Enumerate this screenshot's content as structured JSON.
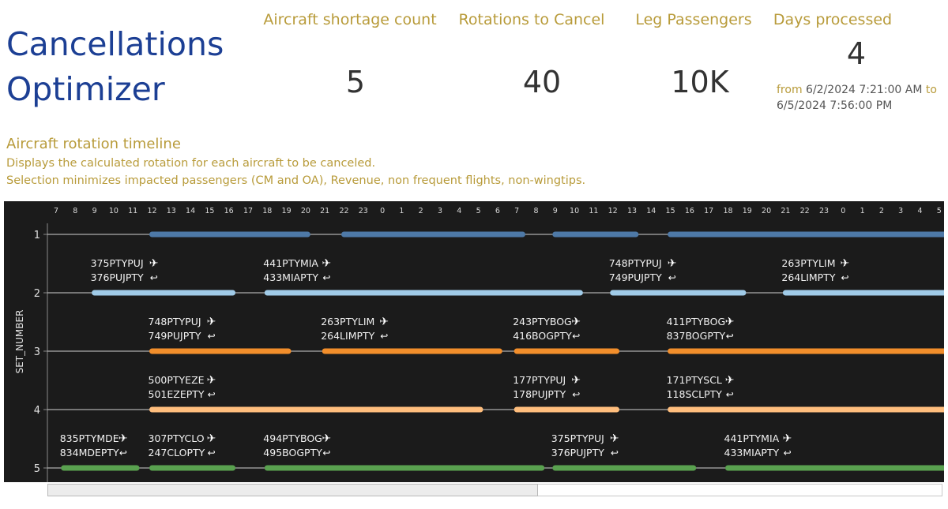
{
  "header": {
    "title": "Cancellations Optimizer"
  },
  "kpis": [
    {
      "label": "Aircraft shortage count",
      "value": "5"
    },
    {
      "label": "Rotations to Cancel",
      "value": "40"
    },
    {
      "label": "Leg Passengers",
      "value": "10K"
    },
    {
      "label": "Days processed",
      "value": "4"
    }
  ],
  "date_range": {
    "from_word": "from",
    "from": "6/2/2024 7:21:00 AM",
    "to_word": "to",
    "to": "6/5/2024 7:56:00 PM"
  },
  "section": {
    "title": "Aircraft rotation timeline",
    "desc1": "Displays the calculated rotation for each aircraft to be canceled.",
    "desc2": "Selection minimizes impacted passengers (CM and OA),  Revenue, non frequent flights, non-wingtips."
  },
  "chart_data": {
    "type": "gantt",
    "ylabel": "SET_NUMBER",
    "x_hours": [
      "7",
      "8",
      "9",
      "10",
      "11",
      "12",
      "13",
      "14",
      "15",
      "16",
      "17",
      "18",
      "19",
      "20",
      "21",
      "22",
      "23",
      "0",
      "1",
      "2",
      "3",
      "4",
      "5",
      "6",
      "7",
      "8",
      "9",
      "10",
      "11",
      "12",
      "13",
      "14",
      "15",
      "16",
      "17",
      "18",
      "19",
      "20",
      "21",
      "22",
      "23",
      "0",
      "1",
      "2",
      "3",
      "4",
      "5"
    ],
    "x_start_hour": 7,
    "x_end_hour": 53.5,
    "series": [
      {
        "set": 1,
        "color": "#4e79a7",
        "bars": [
          [
            12,
            20.1
          ],
          [
            22,
            31.3
          ],
          [
            33,
            37.2
          ],
          [
            39,
            53.5
          ]
        ],
        "labels": []
      },
      {
        "set": 2,
        "color": "#a0cbe8",
        "bars": [
          [
            9,
            16.2
          ],
          [
            18,
            34.3
          ],
          [
            36,
            42.8
          ],
          [
            45,
            53.5
          ]
        ],
        "labels": [
          {
            "at": 9,
            "out": "375PTYPUJ",
            "ret": "376PUJPTY"
          },
          {
            "at": 18,
            "out": "441PTYMIA",
            "ret": "433MIAPTY"
          },
          {
            "at": 36,
            "out": "748PTYPUJ",
            "ret": "749PUJPTY"
          },
          {
            "at": 45,
            "out": "263PTYLIM",
            "ret": "264LIMPTY"
          }
        ]
      },
      {
        "set": 3,
        "color": "#f28e2b",
        "bars": [
          [
            12,
            19.1
          ],
          [
            21,
            30.1
          ],
          [
            31,
            36.2
          ],
          [
            39,
            53.5
          ]
        ],
        "labels": [
          {
            "at": 12,
            "out": "748PTYPUJ",
            "ret": "749PUJPTY"
          },
          {
            "at": 21,
            "out": "263PTYLIM",
            "ret": "264LIMPTY"
          },
          {
            "at": 31,
            "out": "243PTYBOG",
            "ret": "416BOGPTY"
          },
          {
            "at": 39,
            "out": "411PTYBOG",
            "ret": "837BOGPTY"
          }
        ]
      },
      {
        "set": 4,
        "color": "#ffbe7d",
        "bars": [
          [
            12,
            29.1
          ],
          [
            31,
            36.2
          ],
          [
            39,
            53.5
          ]
        ],
        "labels": [
          {
            "at": 12,
            "out": "500PTYEZE",
            "ret": "501EZEPTY"
          },
          {
            "at": 31,
            "out": "177PTYPUJ",
            "ret": "178PUJPTY"
          },
          {
            "at": 39,
            "out": "171PTYSCL",
            "ret": "118SCLPTY"
          }
        ]
      },
      {
        "set": 5,
        "color": "#59a14f",
        "bars": [
          [
            7.4,
            11.2
          ],
          [
            12,
            16.2
          ],
          [
            18,
            32.3
          ],
          [
            33,
            40.2
          ],
          [
            42,
            53.5
          ]
        ],
        "labels": [
          {
            "at": 7.4,
            "out": "835PTYMDE",
            "ret": "834MDEPTY"
          },
          {
            "at": 12,
            "out": "307PTYCLO",
            "ret": "247CLOPTY"
          },
          {
            "at": 18,
            "out": "494PTYBOG",
            "ret": "495BOGPTY"
          },
          {
            "at": 33,
            "out": "375PTYPUJ",
            "ret": "376PUJPTY"
          },
          {
            "at": 42,
            "out": "441PTYMIA",
            "ret": "433MIAPTY"
          }
        ]
      }
    ],
    "y_ticks": [
      "1",
      "2",
      "3",
      "4",
      "5"
    ],
    "icons": {
      "outbound": "airplane-icon",
      "return": "return-arrow-icon"
    }
  }
}
